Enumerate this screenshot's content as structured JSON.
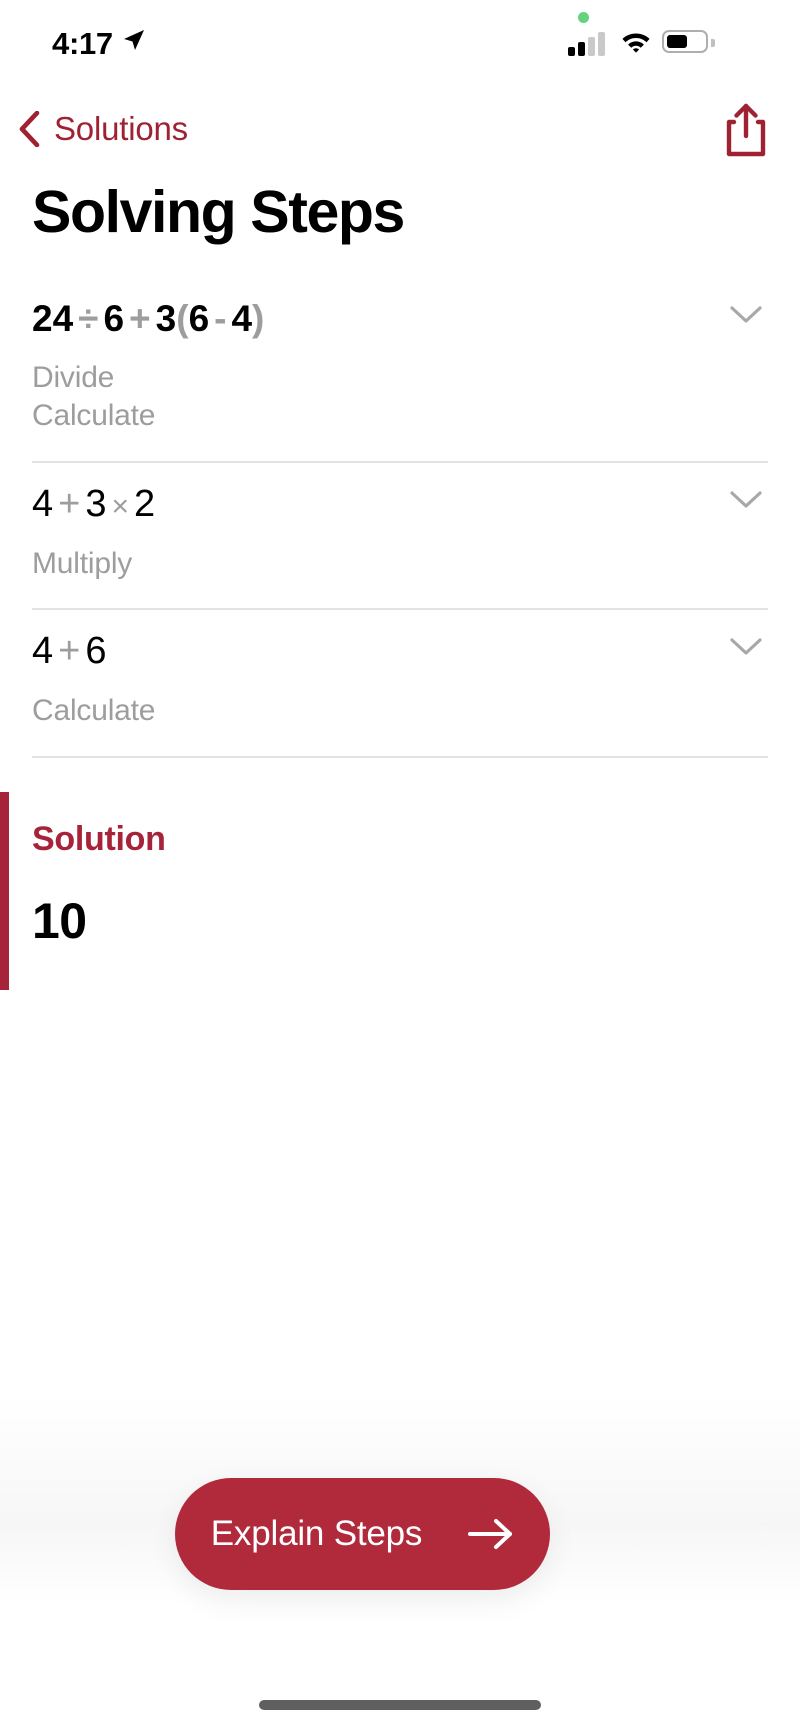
{
  "status_bar": {
    "time": "4:17",
    "location_icon": "location-arrow-icon",
    "recording_dot": "green-privacy-dot",
    "cellular_icon": "cellular-signal-icon",
    "cellular_bars_filled": 2,
    "cellular_bars_total": 4,
    "wifi_icon": "wifi-icon",
    "battery_icon": "battery-icon",
    "battery_level_percent": 50
  },
  "nav_bar": {
    "back_label": "Solutions",
    "back_icon": "chevron-left-icon",
    "share_icon": "share-icon"
  },
  "header": {
    "title": "Solving Steps"
  },
  "steps": [
    {
      "expression_plain": "24 ÷ 6 + 3(6 - 4)",
      "tokens": [
        {
          "t": "24",
          "k": "num"
        },
        {
          "t": "÷",
          "k": "op"
        },
        {
          "t": "6",
          "k": "num"
        },
        {
          "t": "+",
          "k": "op"
        },
        {
          "t": "3",
          "k": "num"
        },
        {
          "t": "(",
          "k": "par"
        },
        {
          "t": "6",
          "k": "num"
        },
        {
          "t": "-",
          "k": "op"
        },
        {
          "t": "4",
          "k": "num"
        },
        {
          "t": ")",
          "k": "par"
        }
      ],
      "bold": true,
      "labels": [
        "Divide",
        "Calculate"
      ],
      "expand_icon": "chevron-down-icon"
    },
    {
      "expression_plain": "4 + 3 × 2",
      "tokens": [
        {
          "t": "4",
          "k": "num"
        },
        {
          "t": "+",
          "k": "op"
        },
        {
          "t": "3",
          "k": "num"
        },
        {
          "t": "×",
          "k": "op mul"
        },
        {
          "t": "2",
          "k": "num"
        }
      ],
      "bold": false,
      "labels": [
        "Multiply"
      ],
      "expand_icon": "chevron-down-icon"
    },
    {
      "expression_plain": "4 + 6",
      "tokens": [
        {
          "t": "4",
          "k": "num"
        },
        {
          "t": "+",
          "k": "op"
        },
        {
          "t": "6",
          "k": "num"
        }
      ],
      "bold": false,
      "labels": [
        "Calculate"
      ],
      "expand_icon": "chevron-down-icon"
    }
  ],
  "solution": {
    "title": "Solution",
    "value": "10"
  },
  "cta": {
    "label": "Explain Steps",
    "icon": "arrow-right-icon"
  },
  "home_indicator": "home-indicator",
  "colors": {
    "accent_red": "#a7233a",
    "button_red": "#b02a3c",
    "muted_gray": "#9d9d9d",
    "divider_gray": "#e3e3e3",
    "text_black": "#000000",
    "privacy_green": "#64d27f"
  }
}
